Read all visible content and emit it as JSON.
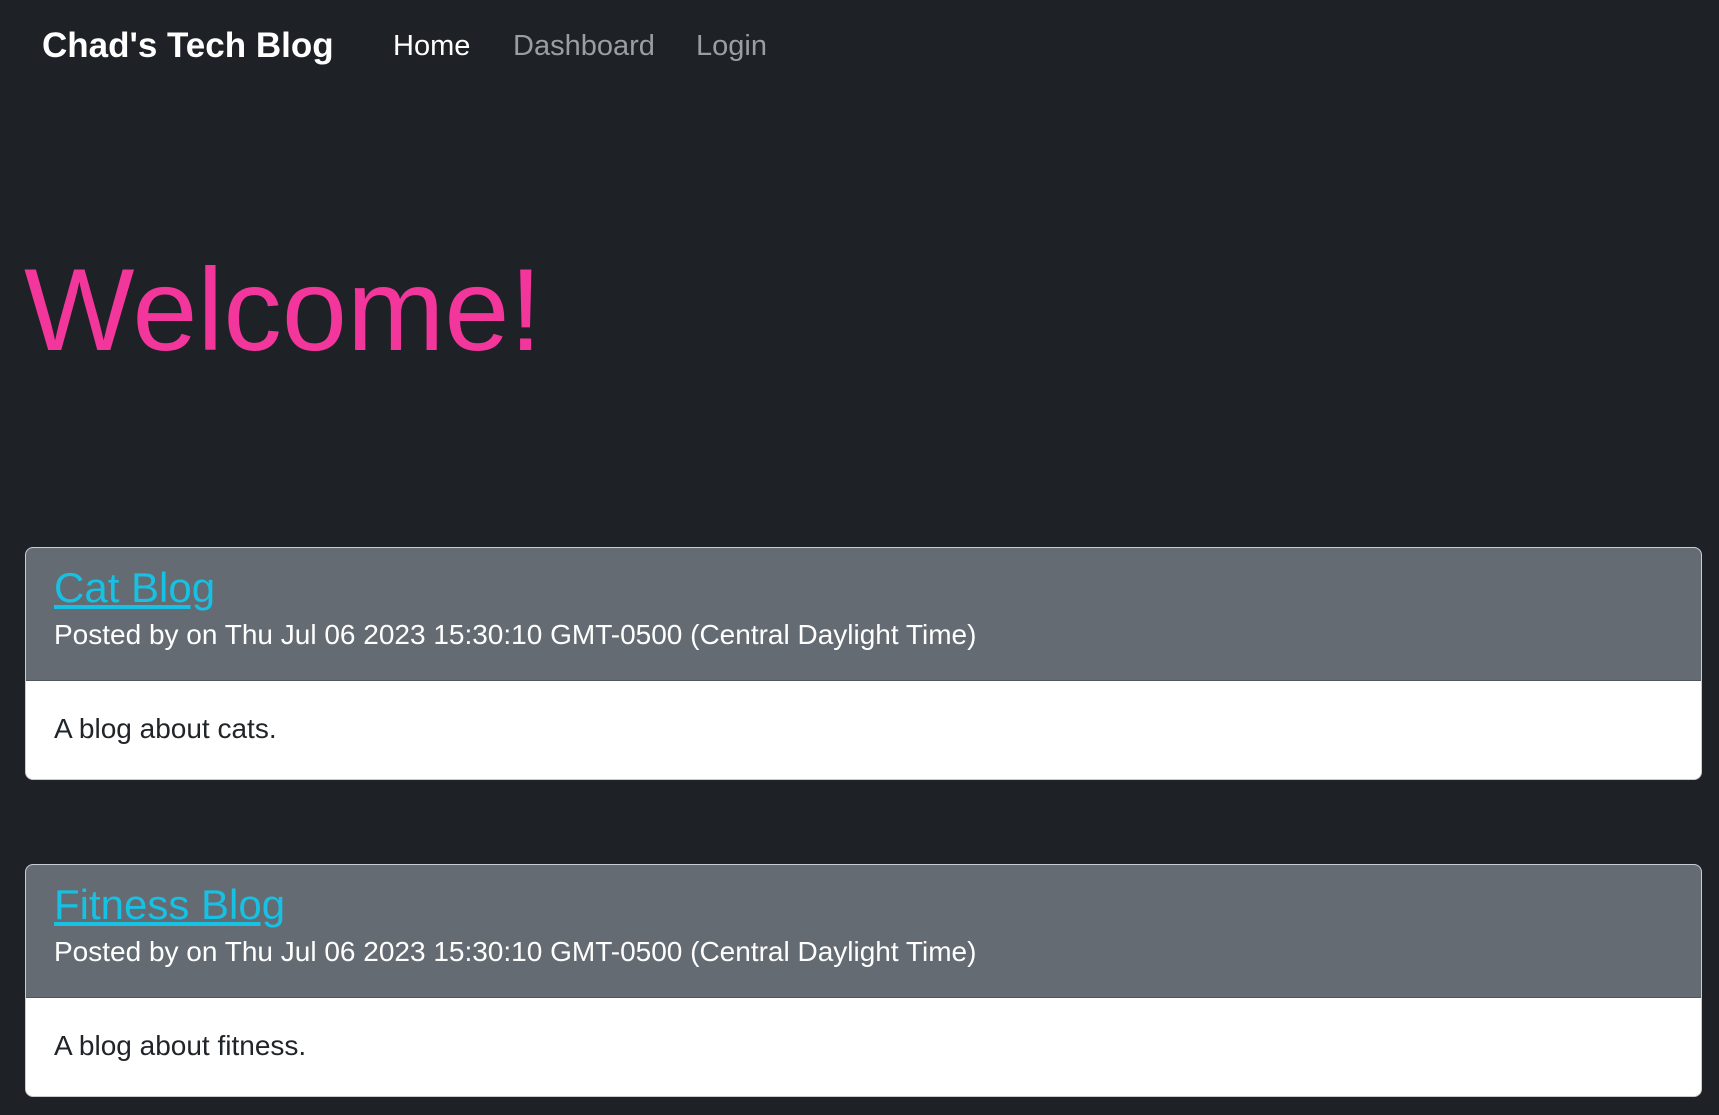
{
  "nav": {
    "brand": "Chad's Tech Blog",
    "links": [
      {
        "label": "Home",
        "active": true
      },
      {
        "label": "Dashboard",
        "active": false
      },
      {
        "label": "Login",
        "active": false
      }
    ]
  },
  "hero": {
    "title": "Welcome!"
  },
  "posts": [
    {
      "title": "Cat Blog",
      "meta": "Posted by on Thu Jul 06 2023 15:30:10 GMT-0500 (Central Daylight Time)",
      "content": "A blog about cats."
    },
    {
      "title": "Fitness Blog",
      "meta": "Posted by on Thu Jul 06 2023 15:30:10 GMT-0500 (Central Daylight Time)",
      "content": "A blog about fitness."
    }
  ],
  "colors": {
    "background": "#1e2125",
    "accent": "#f2369b",
    "link": "#16c1e4",
    "card_header": "#646b72"
  }
}
